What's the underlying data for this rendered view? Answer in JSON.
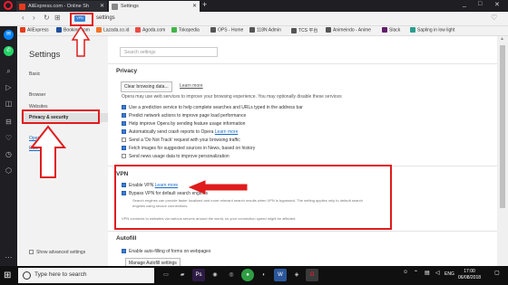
{
  "tabs": [
    {
      "label": "AliExpress.com - Online Sh",
      "close": "✕"
    },
    {
      "label": "Settings",
      "close": "✕"
    }
  ],
  "newtab": "+",
  "window_controls": [
    "_",
    "□",
    "✕"
  ],
  "nav": {
    "back": "‹",
    "forward": "›",
    "reload": "↻",
    "grid": "⊞"
  },
  "address": {
    "badge": "VPN",
    "url": "settings"
  },
  "bookmarks": [
    {
      "label": "AliExpress",
      "color": "#e53a1e"
    },
    {
      "label": "Booking.com",
      "color": "#1f4f9c"
    },
    {
      "label": "Lazada.co.id",
      "color": "#f57224"
    },
    {
      "label": "Agoda.com",
      "color": "#ea4b45"
    },
    {
      "label": "Tokopedia",
      "color": "#42b549"
    },
    {
      "label": "OPS - Home",
      "color": "#555555"
    },
    {
      "label": "118N Admin",
      "color": "#555555"
    },
    {
      "label": "TCS 平台",
      "color": "#555555"
    },
    {
      "label": "Animeindo - Anime",
      "color": "#555555"
    },
    {
      "label": "Slack",
      "color": "#611f69"
    },
    {
      "label": "Sapling in low light",
      "color": "#2a9d8f"
    }
  ],
  "sidebar_icons": [
    "messenger-icon",
    "whatsapp-icon",
    "search-icon",
    "send-icon",
    "snapshot-icon",
    "history-icon",
    "heart-icon",
    "clock-icon",
    "extensions-icon",
    "more-icon"
  ],
  "settings_nav": {
    "title": "Settings",
    "items": [
      "Basic",
      "Browser",
      "Websites",
      "Privacy & security"
    ],
    "links": [
      "Opera help",
      "Rate Opera"
    ],
    "show_advanced": "Show advanced settings"
  },
  "main": {
    "search_placeholder": "Search settings",
    "privacy": {
      "title": "Privacy",
      "clear_button": "Clear browsing data...",
      "learn_more": "Learn more",
      "intro": "Opera may use web services to improve your browsing experience. You may optionally disable these services",
      "options": [
        {
          "label": "Use a prediction service to help complete searches and URLs typed in the address bar",
          "checked": true
        },
        {
          "label": "Predict network actions to improve page load performance",
          "checked": true
        },
        {
          "label": "Help improve Opera by sending feature usage information",
          "checked": true
        },
        {
          "label": "Automatically send crash reports to Opera",
          "checked": true,
          "link": "Learn more"
        },
        {
          "label": "Send a 'Do Not Track' request with your browsing traffic",
          "checked": false
        },
        {
          "label": "Fetch images for suggested sources in News, based on history",
          "checked": true
        },
        {
          "label": "Send news usage data to improve personalization",
          "checked": false
        }
      ]
    },
    "vpn": {
      "title": "VPN",
      "enable_label": "Enable VPN",
      "enable_link": "Learn more",
      "bypass_label": "Bypass VPN for default search engines",
      "bypass_help_1": "Search engines can provide faster localized and more relevant search results when VPN is bypassed. The setting applies only to default search",
      "bypass_help_2": "engines using secure connections.",
      "note": "VPN connects to websites via various servers around the world, so your connection speed might be affected."
    },
    "autofill": {
      "title": "Autofill",
      "enable_label": "Enable auto-filling of forms on webpages",
      "manage_button": "Manage Autofill settings"
    }
  },
  "taskbar": {
    "search_text": "Type here to search",
    "lang": "ENG",
    "time": "17:00",
    "date": "06/08/2018"
  },
  "colors": {
    "annotation_red": "#e01c1c",
    "opera_red": "#ff1b2d",
    "link_blue": "#1a6dc7"
  }
}
